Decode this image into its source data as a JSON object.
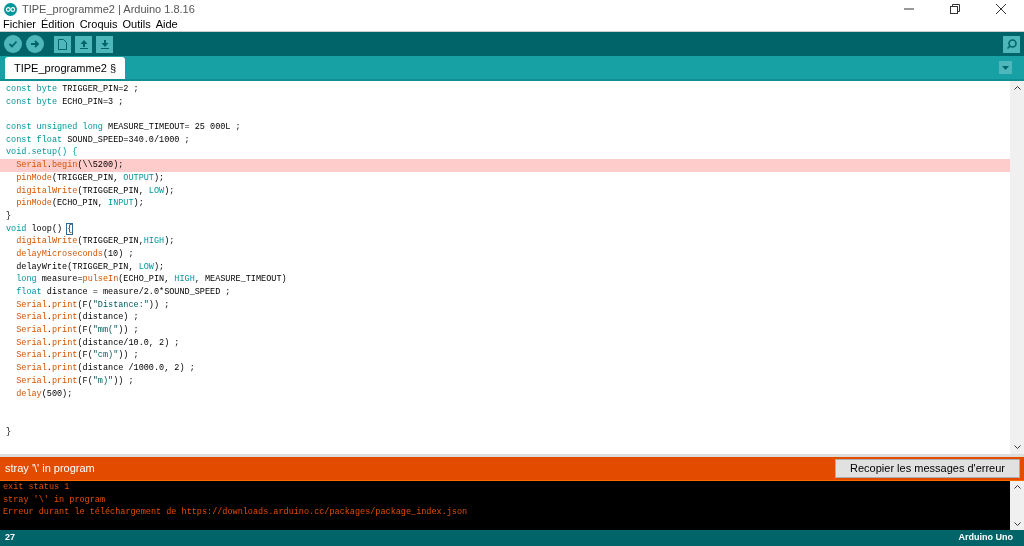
{
  "window": {
    "title": "TIPE_programme2 | Arduino 1.8.16"
  },
  "menu": [
    "Fichier",
    "Édition",
    "Croquis",
    "Outils",
    "Aide"
  ],
  "tab": {
    "label": "TIPE_programme2 §",
    "selected": true
  },
  "editor": {
    "lines": [
      {
        "kind": "code",
        "highlighted": false,
        "tokens": [
          {
            "text": "const",
            "kind": "type"
          },
          {
            "text": " byte",
            "kind": "type"
          },
          {
            "text": " TRIGGER_PIN=2 ;",
            "kind": "plain"
          }
        ]
      },
      {
        "kind": "code",
        "highlighted": false,
        "tokens": [
          {
            "text": "const",
            "kind": "type"
          },
          {
            "text": " byte",
            "kind": "type"
          },
          {
            "text": " ECHO_PIN=3 ;",
            "kind": "plain"
          }
        ]
      },
      {
        "kind": "blank"
      },
      {
        "kind": "code",
        "highlighted": false,
        "tokens": [
          {
            "text": "const",
            "kind": "type"
          },
          {
            "text": " unsigned",
            "kind": "type"
          },
          {
            "text": " long",
            "kind": "type"
          },
          {
            "text": " MEASURE_TIMEOUT= 25 000L ;",
            "kind": "plain"
          }
        ]
      },
      {
        "kind": "code",
        "highlighted": false,
        "tokens": [
          {
            "text": "const",
            "kind": "type"
          },
          {
            "text": " float",
            "kind": "type"
          },
          {
            "text": " SOUND_SPEED=340.0/1000 ;",
            "kind": "plain"
          }
        ]
      },
      {
        "kind": "code",
        "highlighted": false,
        "tokens": [
          {
            "text": "void.setup() {",
            "kind": "type"
          }
        ]
      },
      {
        "kind": "code",
        "highlighted": true,
        "tokens": [
          {
            "text": "  Serial",
            "kind": "func"
          },
          {
            "text": ".",
            "kind": "plain"
          },
          {
            "text": "begin",
            "kind": "func"
          },
          {
            "text": "(\\\\5200);",
            "kind": "plain"
          }
        ]
      },
      {
        "kind": "code",
        "highlighted": false,
        "tokens": [
          {
            "text": "  pinMode",
            "kind": "func"
          },
          {
            "text": "(TRIGGER_PIN, ",
            "kind": "plain"
          },
          {
            "text": "OUTPUT",
            "kind": "const"
          },
          {
            "text": ");",
            "kind": "plain"
          }
        ]
      },
      {
        "kind": "code",
        "highlighted": false,
        "tokens": [
          {
            "text": "  digitalWrite",
            "kind": "func"
          },
          {
            "text": "(TRIGGER_PIN, ",
            "kind": "plain"
          },
          {
            "text": "LOW",
            "kind": "const"
          },
          {
            "text": ");",
            "kind": "plain"
          }
        ]
      },
      {
        "kind": "code",
        "highlighted": false,
        "tokens": [
          {
            "text": "  pinMode",
            "kind": "func"
          },
          {
            "text": "(ECHO_PIN, ",
            "kind": "plain"
          },
          {
            "text": "INPUT",
            "kind": "const"
          },
          {
            "text": ");",
            "kind": "plain"
          }
        ]
      },
      {
        "kind": "code",
        "highlighted": false,
        "tokens": [
          {
            "text": "}",
            "kind": "plain"
          }
        ]
      },
      {
        "kind": "code",
        "highlighted": false,
        "tokens": [
          {
            "text": "void",
            "kind": "type"
          },
          {
            "text": " loop() ",
            "kind": "plain"
          },
          {
            "text": "{",
            "kind": "bracket"
          }
        ]
      },
      {
        "kind": "code",
        "highlighted": false,
        "tokens": [
          {
            "text": "  digitalWrite",
            "kind": "func"
          },
          {
            "text": "(TRIGGER_PIN,",
            "kind": "plain"
          },
          {
            "text": "HIGH",
            "kind": "const"
          },
          {
            "text": ");",
            "kind": "plain"
          }
        ]
      },
      {
        "kind": "code",
        "highlighted": false,
        "tokens": [
          {
            "text": "  delayMicroseconds",
            "kind": "func"
          },
          {
            "text": "(10) ;",
            "kind": "plain"
          }
        ]
      },
      {
        "kind": "code",
        "highlighted": false,
        "tokens": [
          {
            "text": "  delayWrite(TRIGGER_PIN, ",
            "kind": "plain"
          },
          {
            "text": "LOW",
            "kind": "const"
          },
          {
            "text": ");",
            "kind": "plain"
          }
        ]
      },
      {
        "kind": "code",
        "highlighted": false,
        "tokens": [
          {
            "text": "  long",
            "kind": "type"
          },
          {
            "text": " measure=",
            "kind": "plain"
          },
          {
            "text": "pulseIn",
            "kind": "func"
          },
          {
            "text": "(ECHO_PIN, ",
            "kind": "plain"
          },
          {
            "text": "HIGH",
            "kind": "const"
          },
          {
            "text": ", MEASURE_TIMEOUT)",
            "kind": "plain"
          }
        ]
      },
      {
        "kind": "code",
        "highlighted": false,
        "tokens": [
          {
            "text": "  float",
            "kind": "type"
          },
          {
            "text": " distance = measure/2.0*SOUND_SPEED ;",
            "kind": "plain"
          }
        ]
      },
      {
        "kind": "code",
        "highlighted": false,
        "tokens": [
          {
            "text": "  Serial",
            "kind": "func"
          },
          {
            "text": ".",
            "kind": "plain"
          },
          {
            "text": "print",
            "kind": "func"
          },
          {
            "text": "(F(",
            "kind": "plain"
          },
          {
            "text": "\"Distance:\"",
            "kind": "string"
          },
          {
            "text": ")) ;",
            "kind": "plain"
          }
        ]
      },
      {
        "kind": "code",
        "highlighted": false,
        "tokens": [
          {
            "text": "  Serial",
            "kind": "func"
          },
          {
            "text": ".",
            "kind": "plain"
          },
          {
            "text": "print",
            "kind": "func"
          },
          {
            "text": "(distance) ;",
            "kind": "plain"
          }
        ]
      },
      {
        "kind": "code",
        "highlighted": false,
        "tokens": [
          {
            "text": "  Serial",
            "kind": "func"
          },
          {
            "text": ".",
            "kind": "plain"
          },
          {
            "text": "print",
            "kind": "func"
          },
          {
            "text": "(F(",
            "kind": "plain"
          },
          {
            "text": "\"mm(\"",
            "kind": "string"
          },
          {
            "text": ")) ;",
            "kind": "plain"
          }
        ]
      },
      {
        "kind": "code",
        "highlighted": false,
        "tokens": [
          {
            "text": "  Serial",
            "kind": "func"
          },
          {
            "text": ".",
            "kind": "plain"
          },
          {
            "text": "print",
            "kind": "func"
          },
          {
            "text": "(distance/10.0, 2) ;",
            "kind": "plain"
          }
        ]
      },
      {
        "kind": "code",
        "highlighted": false,
        "tokens": [
          {
            "text": "  Serial",
            "kind": "func"
          },
          {
            "text": ".",
            "kind": "plain"
          },
          {
            "text": "print",
            "kind": "func"
          },
          {
            "text": "(F(",
            "kind": "plain"
          },
          {
            "text": "\"cm)\"",
            "kind": "string"
          },
          {
            "text": ")) ;",
            "kind": "plain"
          }
        ]
      },
      {
        "kind": "code",
        "highlighted": false,
        "tokens": [
          {
            "text": "  Serial",
            "kind": "func"
          },
          {
            "text": ".",
            "kind": "plain"
          },
          {
            "text": "print",
            "kind": "func"
          },
          {
            "text": "(distance /1000.0, 2) ;",
            "kind": "plain"
          }
        ]
      },
      {
        "kind": "code",
        "highlighted": false,
        "tokens": [
          {
            "text": "  Serial",
            "kind": "func"
          },
          {
            "text": ".",
            "kind": "plain"
          },
          {
            "text": "print",
            "kind": "func"
          },
          {
            "text": "(F(",
            "kind": "plain"
          },
          {
            "text": "\"m)\"",
            "kind": "string"
          },
          {
            "text": ")) ;",
            "kind": "plain"
          }
        ]
      },
      {
        "kind": "code",
        "highlighted": false,
        "tokens": [
          {
            "text": "  delay",
            "kind": "func"
          },
          {
            "text": "(500);",
            "kind": "plain"
          }
        ]
      },
      {
        "kind": "blank"
      },
      {
        "kind": "blank"
      },
      {
        "kind": "code",
        "highlighted": false,
        "tokens": [
          {
            "text": "}",
            "kind": "plain"
          }
        ]
      }
    ]
  },
  "error_bar": {
    "message": "stray '\\' in program",
    "button": "Recopier les messages d'erreur"
  },
  "console": [
    "exit status 1",
    "stray '\\' in program",
    "Erreur durant le téléchargement de https://downloads.arduino.cc/packages/package_index.json"
  ],
  "status_bar": {
    "line": "27",
    "board": "Arduino Uno"
  }
}
